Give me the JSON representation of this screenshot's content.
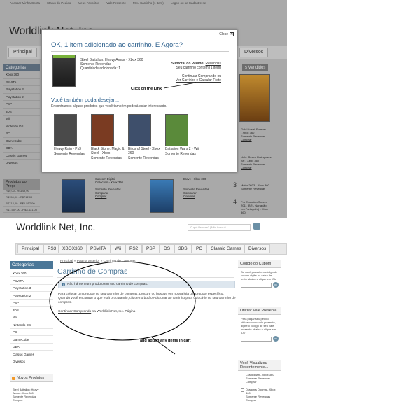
{
  "top": {
    "toplinks": [
      "Acessar Minha Conta",
      "Status do Pedido",
      "Meus Favoritos",
      "Vale Presente",
      "Meu Carrinho (1 item)",
      "Logon ou se Cadastre-se"
    ],
    "logo": "Worldlink Net, Inc",
    "nav_first": "Principal",
    "nav_last": "Diversos",
    "sidebar": {
      "heading": "Categorias",
      "items": [
        "Xbox 360",
        "PSVITA",
        "Playstation 3",
        "Playstation 2",
        "PSP",
        "3DS",
        "Wii",
        "Nintendo DS",
        "PC",
        "GameCube",
        "GBA",
        "Classic Games",
        "Diversos"
      ],
      "price_heading": "Produtos por Preço",
      "prices": [
        "R$0,00 - R$149,00",
        "R$150,00 - R$712,00",
        "R$712,00 - R$1.557,00",
        "R$1.557,00 - R$3.431,00"
      ]
    },
    "right": {
      "heading": "s Vendidos",
      "item1": [
        "Gold Nostril Forever",
        "- Xbox 360",
        "Somente Revendas",
        "Comprar"
      ],
      "item2": [
        "Halo: Reach Portuguesa",
        "BR - Xbox 360",
        "Somente Revendas",
        "Comprar"
      ],
      "item3_num": "3",
      "item3": [
        "Metro 2033 - Xbox 360",
        "Somente Revendas"
      ],
      "item4_num": "4",
      "item4": [
        "Pro Evolution Soccer",
        "2011 (BR - Narração",
        "em Português) - Xbox",
        "360"
      ]
    },
    "lower": {
      "item_a": [
        "Capcom Digital",
        "Collection - Xbox 360",
        "",
        "Somente Revendas",
        "Comparar",
        "Comprar"
      ],
      "item_b": [
        "Brave - Xbox 360",
        "",
        "",
        "Somente Revendas",
        "Comparar",
        "Comprar"
      ]
    },
    "modal": {
      "close_label": "Close",
      "close_icon": "close-icon",
      "title": "OK, 1 item adicionado ao carrinho. E Agora?",
      "added": {
        "name": "Steel Battalion: Heavy Armor - Xbox 360",
        "resellers": "Somente Revendas",
        "qty": "Quantidade adicionada: 1"
      },
      "subtotal_label": "Subtotal do Pedido:",
      "subtotal_value": "Revendas",
      "cart_count": "Seu carrinho contém (1 item)",
      "continue_label": "Continuar Comprando",
      "or_label": "ou",
      "checkout_label": "Ver Carrinho e Calcular Frete",
      "annotation": "Click on the Link",
      "maybe_title": "Você também poda desejar...",
      "maybe_subtitle": "Encontramos alguns produtos que você também poderá estar interessado.",
      "products": [
        {
          "name": "Heavy Rain - Ps3",
          "resellers": "Somente Revendas",
          "color": "#4a4a4a"
        },
        {
          "name": "Black Stone: Magic & Steel - Xbox",
          "resellers": "Somente Revendas",
          "color": "#7a3b22"
        },
        {
          "name": "Birds of Steel - Xbox 360",
          "resellers": "Somente Revendas",
          "color": "#3e4f6b"
        },
        {
          "name": "Battalion Wars 2 - Wii",
          "resellers": "Somente Revendas",
          "color": "#5a8a3a"
        }
      ]
    }
  },
  "bottom": {
    "logo": "Worldlink Net, Inc.",
    "search_placeholder": "O quê Procura? | Não Achou?",
    "nav": [
      "Principal",
      "PS3",
      "XBOX360",
      "PSVITA",
      "Wii",
      "PS2",
      "PSP",
      "DS",
      "3DS",
      "PC",
      "Classic Games",
      "Diversos"
    ],
    "sidebar": {
      "heading": "Categorias",
      "items": [
        "Xbox 360",
        "PSVITA",
        "Playstation 3",
        "Playstation 2",
        "PSP",
        "3DS",
        "Wii",
        "Nintendo DS",
        "PC",
        "GameCube",
        "GBA",
        "Classic Games",
        "Diversos"
      ]
    },
    "novos": {
      "heading": "Novos Produtos",
      "lines": [
        "Steel Battalion: Heavy",
        "Armor - Xbox 360",
        "Somente Revendas",
        "Comprar"
      ]
    },
    "breadcrumb": {
      "home": "Principal",
      "sep": "»",
      "prev": "Página anterior",
      "current": "Carrinho de Compras"
    },
    "title": "Carrinho de Compras",
    "info": "Não há nenhum produto em seu carrinho de compras.",
    "paragraph": "Para colocar um produto no seu carrinho de compras, procure ou busque em nossa loja um produto específico. Quando você encontrar o que está procurando, clique no botão Adicionar ao carrinho para colocá-lo no seu carrinho de compras.",
    "continue_link": "Continuar Comprando",
    "continue_rest": "na Worldlink Net, Inc. Página",
    "annotation": "and added any items in cart",
    "coupon": {
      "heading": "Código do Cupom",
      "text": "Se você possui um código de cupom digite na caixa de texto abaixo e clique em 'Ok'",
      "button": "OK"
    },
    "gift": {
      "heading": "Utilizar Vale Presente",
      "text": "Para pagar seu pedido utilizando um vale presente, digite o código de seu vale presente abaixo e clique em 'Ok'",
      "button": "OK"
    },
    "recent": {
      "heading": "Você Visualizou Recentemente...",
      "items": [
        {
          "name": "Crackdown - Xbox 360",
          "resellers": "Somente Revendas",
          "buy": "Comprar"
        },
        {
          "name": "Dragon's Dogma - Xbox 360",
          "resellers": "Somente Revendas",
          "buy": "Comprar"
        }
      ]
    }
  }
}
